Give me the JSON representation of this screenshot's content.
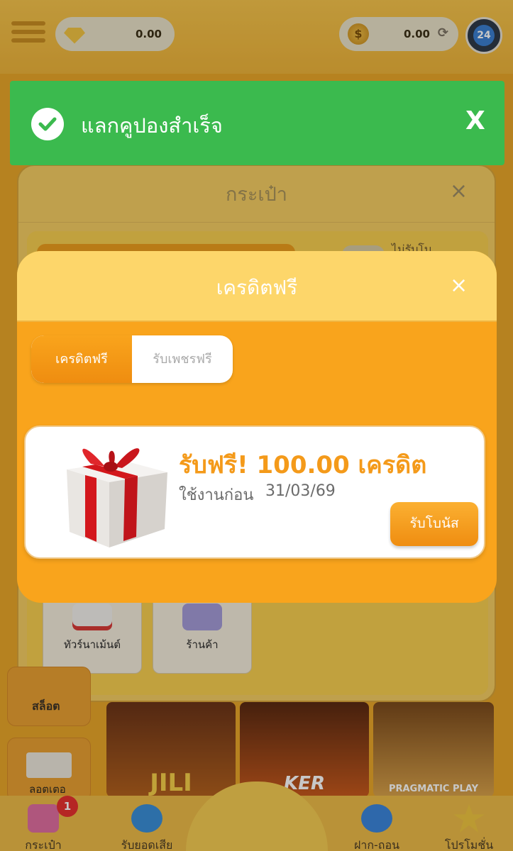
{
  "header": {
    "diamond_balance": "0.00",
    "coin_balance": "0.00",
    "support_label": "24"
  },
  "toast": {
    "message": "แลกคูปองสำเร็จ",
    "close_label": "X",
    "color": "#3bba4e"
  },
  "wallet_panel": {
    "title": "กระเป๋า",
    "close_label": "×",
    "toggle_label": "ไม่รับโบ",
    "cards": [
      {
        "label": "ทัวร์นาเม้นต์",
        "icon": "tournament-icon"
      },
      {
        "label": "ร้านค้า",
        "icon": "shop-icon"
      }
    ]
  },
  "side_menu": {
    "slot_label": "สล็อต",
    "lotto_label": "ลอตเตอ"
  },
  "games": [
    {
      "label": "JILI"
    },
    {
      "label": "KER"
    },
    {
      "label": "PRAGMATIC PLAY"
    }
  ],
  "bottom_nav": {
    "items": [
      {
        "label": "กระเป๋า",
        "icon": "wallet-icon"
      },
      {
        "label": "รับยอดเสีย",
        "icon": "cashback-icon"
      },
      {
        "label": "ฝาก-ถอน",
        "icon": "deposit-withdraw-icon"
      },
      {
        "label": "โปรโมชั่น",
        "icon": "promotion-icon"
      }
    ],
    "wallet_badge": "1"
  },
  "credit_modal": {
    "title": "เครดิตฟรี",
    "close_label": "×",
    "tabs": [
      {
        "label": "เครดิตฟรี",
        "active": true
      },
      {
        "label": "รับเพชรฟรี",
        "active": false
      }
    ],
    "bonus": {
      "title": "รับฟรี! 100.00 เครดิต",
      "expiry_label": "ใช้งานก่อน",
      "expiry_date": "31/03/69",
      "claim_label": "รับโบนัส",
      "icon": "gift-box-icon"
    },
    "accent_color": "#f9a41c"
  }
}
